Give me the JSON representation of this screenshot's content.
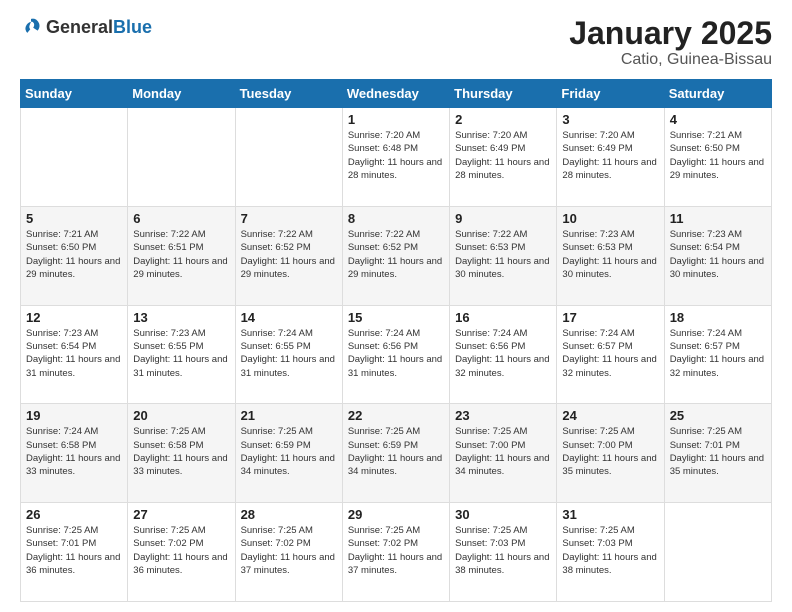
{
  "header": {
    "logo": {
      "general": "General",
      "blue": "Blue"
    },
    "title": "January 2025",
    "subtitle": "Catio, Guinea-Bissau"
  },
  "days_of_week": [
    "Sunday",
    "Monday",
    "Tuesday",
    "Wednesday",
    "Thursday",
    "Friday",
    "Saturday"
  ],
  "weeks": [
    [
      null,
      null,
      null,
      {
        "day": 1,
        "sunrise": "Sunrise: 7:20 AM",
        "sunset": "Sunset: 6:48 PM",
        "daylight": "Daylight: 11 hours and 28 minutes."
      },
      {
        "day": 2,
        "sunrise": "Sunrise: 7:20 AM",
        "sunset": "Sunset: 6:49 PM",
        "daylight": "Daylight: 11 hours and 28 minutes."
      },
      {
        "day": 3,
        "sunrise": "Sunrise: 7:20 AM",
        "sunset": "Sunset: 6:49 PM",
        "daylight": "Daylight: 11 hours and 28 minutes."
      },
      {
        "day": 4,
        "sunrise": "Sunrise: 7:21 AM",
        "sunset": "Sunset: 6:50 PM",
        "daylight": "Daylight: 11 hours and 29 minutes."
      }
    ],
    [
      {
        "day": 5,
        "sunrise": "Sunrise: 7:21 AM",
        "sunset": "Sunset: 6:50 PM",
        "daylight": "Daylight: 11 hours and 29 minutes."
      },
      {
        "day": 6,
        "sunrise": "Sunrise: 7:22 AM",
        "sunset": "Sunset: 6:51 PM",
        "daylight": "Daylight: 11 hours and 29 minutes."
      },
      {
        "day": 7,
        "sunrise": "Sunrise: 7:22 AM",
        "sunset": "Sunset: 6:52 PM",
        "daylight": "Daylight: 11 hours and 29 minutes."
      },
      {
        "day": 8,
        "sunrise": "Sunrise: 7:22 AM",
        "sunset": "Sunset: 6:52 PM",
        "daylight": "Daylight: 11 hours and 29 minutes."
      },
      {
        "day": 9,
        "sunrise": "Sunrise: 7:22 AM",
        "sunset": "Sunset: 6:53 PM",
        "daylight": "Daylight: 11 hours and 30 minutes."
      },
      {
        "day": 10,
        "sunrise": "Sunrise: 7:23 AM",
        "sunset": "Sunset: 6:53 PM",
        "daylight": "Daylight: 11 hours and 30 minutes."
      },
      {
        "day": 11,
        "sunrise": "Sunrise: 7:23 AM",
        "sunset": "Sunset: 6:54 PM",
        "daylight": "Daylight: 11 hours and 30 minutes."
      }
    ],
    [
      {
        "day": 12,
        "sunrise": "Sunrise: 7:23 AM",
        "sunset": "Sunset: 6:54 PM",
        "daylight": "Daylight: 11 hours and 31 minutes."
      },
      {
        "day": 13,
        "sunrise": "Sunrise: 7:23 AM",
        "sunset": "Sunset: 6:55 PM",
        "daylight": "Daylight: 11 hours and 31 minutes."
      },
      {
        "day": 14,
        "sunrise": "Sunrise: 7:24 AM",
        "sunset": "Sunset: 6:55 PM",
        "daylight": "Daylight: 11 hours and 31 minutes."
      },
      {
        "day": 15,
        "sunrise": "Sunrise: 7:24 AM",
        "sunset": "Sunset: 6:56 PM",
        "daylight": "Daylight: 11 hours and 31 minutes."
      },
      {
        "day": 16,
        "sunrise": "Sunrise: 7:24 AM",
        "sunset": "Sunset: 6:56 PM",
        "daylight": "Daylight: 11 hours and 32 minutes."
      },
      {
        "day": 17,
        "sunrise": "Sunrise: 7:24 AM",
        "sunset": "Sunset: 6:57 PM",
        "daylight": "Daylight: 11 hours and 32 minutes."
      },
      {
        "day": 18,
        "sunrise": "Sunrise: 7:24 AM",
        "sunset": "Sunset: 6:57 PM",
        "daylight": "Daylight: 11 hours and 32 minutes."
      }
    ],
    [
      {
        "day": 19,
        "sunrise": "Sunrise: 7:24 AM",
        "sunset": "Sunset: 6:58 PM",
        "daylight": "Daylight: 11 hours and 33 minutes."
      },
      {
        "day": 20,
        "sunrise": "Sunrise: 7:25 AM",
        "sunset": "Sunset: 6:58 PM",
        "daylight": "Daylight: 11 hours and 33 minutes."
      },
      {
        "day": 21,
        "sunrise": "Sunrise: 7:25 AM",
        "sunset": "Sunset: 6:59 PM",
        "daylight": "Daylight: 11 hours and 34 minutes."
      },
      {
        "day": 22,
        "sunrise": "Sunrise: 7:25 AM",
        "sunset": "Sunset: 6:59 PM",
        "daylight": "Daylight: 11 hours and 34 minutes."
      },
      {
        "day": 23,
        "sunrise": "Sunrise: 7:25 AM",
        "sunset": "Sunset: 7:00 PM",
        "daylight": "Daylight: 11 hours and 34 minutes."
      },
      {
        "day": 24,
        "sunrise": "Sunrise: 7:25 AM",
        "sunset": "Sunset: 7:00 PM",
        "daylight": "Daylight: 11 hours and 35 minutes."
      },
      {
        "day": 25,
        "sunrise": "Sunrise: 7:25 AM",
        "sunset": "Sunset: 7:01 PM",
        "daylight": "Daylight: 11 hours and 35 minutes."
      }
    ],
    [
      {
        "day": 26,
        "sunrise": "Sunrise: 7:25 AM",
        "sunset": "Sunset: 7:01 PM",
        "daylight": "Daylight: 11 hours and 36 minutes."
      },
      {
        "day": 27,
        "sunrise": "Sunrise: 7:25 AM",
        "sunset": "Sunset: 7:02 PM",
        "daylight": "Daylight: 11 hours and 36 minutes."
      },
      {
        "day": 28,
        "sunrise": "Sunrise: 7:25 AM",
        "sunset": "Sunset: 7:02 PM",
        "daylight": "Daylight: 11 hours and 37 minutes."
      },
      {
        "day": 29,
        "sunrise": "Sunrise: 7:25 AM",
        "sunset": "Sunset: 7:02 PM",
        "daylight": "Daylight: 11 hours and 37 minutes."
      },
      {
        "day": 30,
        "sunrise": "Sunrise: 7:25 AM",
        "sunset": "Sunset: 7:03 PM",
        "daylight": "Daylight: 11 hours and 38 minutes."
      },
      {
        "day": 31,
        "sunrise": "Sunrise: 7:25 AM",
        "sunset": "Sunset: 7:03 PM",
        "daylight": "Daylight: 11 hours and 38 minutes."
      },
      null
    ]
  ]
}
